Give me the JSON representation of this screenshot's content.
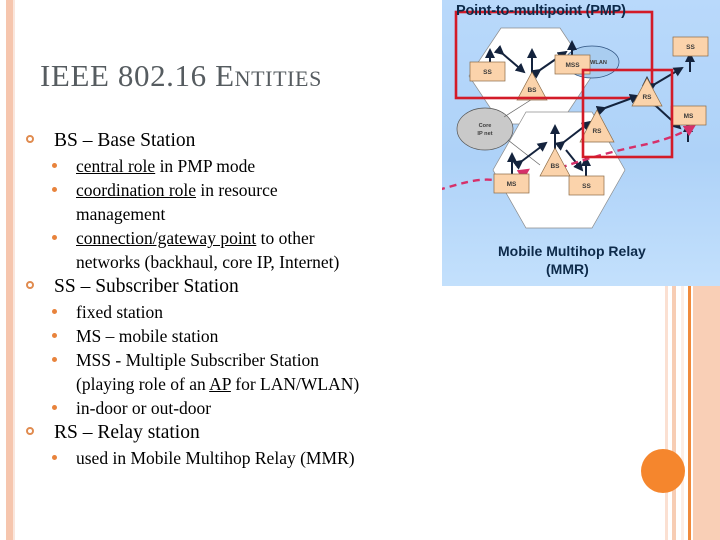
{
  "slide": {
    "title": "IEEE 802.16 E",
    "title_full": "IEEE 802.16 Entities",
    "accent_color": "#f5862d",
    "bullet_ring_color": "#e08b4f",
    "bullet_dot_color": "#e8833c",
    "title_color": "#565c60"
  },
  "bullets": [
    {
      "label": "BS – Base Station",
      "sub": [
        {
          "pre": "",
          "em": "central role",
          "post": " in PMP mode"
        },
        {
          "pre": "",
          "em": "coordination role",
          "post": " in resource",
          "cont": "management"
        },
        {
          "pre": "",
          "em": "connection/gateway point",
          "post": " to other",
          "cont": "networks (backhaul, core IP, Internet)"
        }
      ]
    },
    {
      "label": "SS – Subscriber Station",
      "sub": [
        {
          "pre": "fixed station",
          "em": "",
          "post": ""
        },
        {
          "pre": "MS – mobile station",
          "em": "",
          "post": ""
        },
        {
          "pre": "MSS - Multiple Subscriber Station",
          "em": "",
          "post": "",
          "cont_pre": "(playing role of an ",
          "cont_em": "AP",
          "cont_post": " for LAN/WLAN)"
        },
        {
          "pre": "in-door or out-door",
          "em": "",
          "post": ""
        }
      ]
    },
    {
      "label": "RS – Relay station",
      "sub": [
        {
          "pre": "used in Mobile Multihop Relay (MMR)",
          "em": "",
          "post": ""
        }
      ]
    }
  ],
  "diagram": {
    "pmp_title": "Point-to-multipoint (PMP)",
    "mmr_title_line1": "Mobile Multihop Relay",
    "mmr_title_line2": "(MMR)",
    "background_color": "#aed2f8",
    "box_border_color": "#d31b28",
    "node_fill_color": "#fbd3ab",
    "core_fill_color": "#c9c9c9",
    "lan_fill_color": "#a9cdf0",
    "mobility_path_color": "#d6306a",
    "pmp_nodes": [
      {
        "id": "pmp-ss",
        "label": "SS",
        "shape": "box"
      },
      {
        "id": "pmp-mss",
        "label": "MSS",
        "shape": "box"
      },
      {
        "id": "pmp-bs",
        "label": "BS",
        "shape": "triangle"
      },
      {
        "id": "pmp-lanwlan",
        "label": "LAN/WLAN",
        "shape": "ellipse"
      }
    ],
    "mmr_nodes": [
      {
        "id": "mmr-core",
        "label": "Core",
        "label2": "IP net",
        "shape": "ellipse"
      },
      {
        "id": "mmr-ms-left",
        "label": "MS",
        "shape": "box"
      },
      {
        "id": "mmr-bs",
        "label": "BS",
        "shape": "triangle"
      },
      {
        "id": "mmr-ss-bottom",
        "label": "SS",
        "shape": "box"
      },
      {
        "id": "mmr-rs-left",
        "label": "RS",
        "shape": "triangle"
      },
      {
        "id": "mmr-rs-right",
        "label": "RS",
        "shape": "triangle"
      },
      {
        "id": "mmr-ss-right",
        "label": "SS",
        "shape": "box"
      },
      {
        "id": "mmr-ms-right",
        "label": "MS",
        "shape": "box"
      }
    ]
  }
}
